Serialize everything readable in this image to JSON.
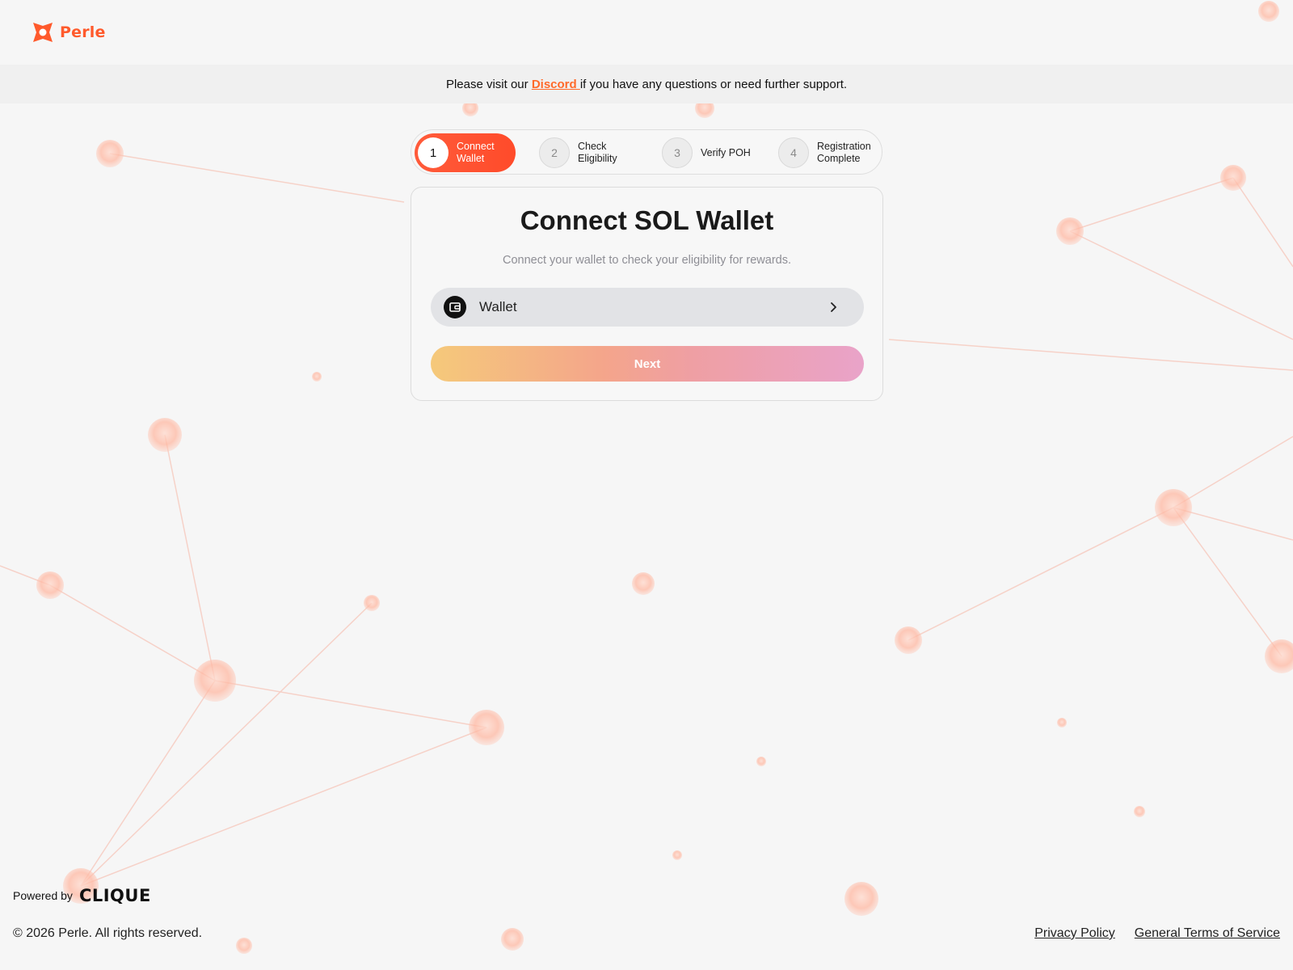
{
  "brand": {
    "name": "Perle",
    "accent": "#ff5a2c"
  },
  "notice": {
    "prefix": "Please visit our ",
    "link_text": "Discord ",
    "suffix": "if you have any questions or need further support."
  },
  "stepper": {
    "steps": [
      {
        "number": "1",
        "label": "Connect\nWallet",
        "active": true
      },
      {
        "number": "2",
        "label": "Check\nEligibility",
        "active": false
      },
      {
        "number": "3",
        "label": "Verify POH",
        "active": false
      },
      {
        "number": "4",
        "label": "Registration\nComplete",
        "active": false
      }
    ]
  },
  "card": {
    "title": "Connect SOL Wallet",
    "subtitle": "Connect your wallet to check your eligibility for rewards.",
    "wallet_label": "Wallet",
    "wallet_icon": "wallet-icon",
    "next_label": "Next"
  },
  "footer": {
    "powered_by": "Powered by",
    "powered_brand": "CLIQUE",
    "copyright": "© 2026 Perle. All rights reserved.",
    "privacy": "Privacy Policy",
    "terms": "General Terms of Service"
  }
}
